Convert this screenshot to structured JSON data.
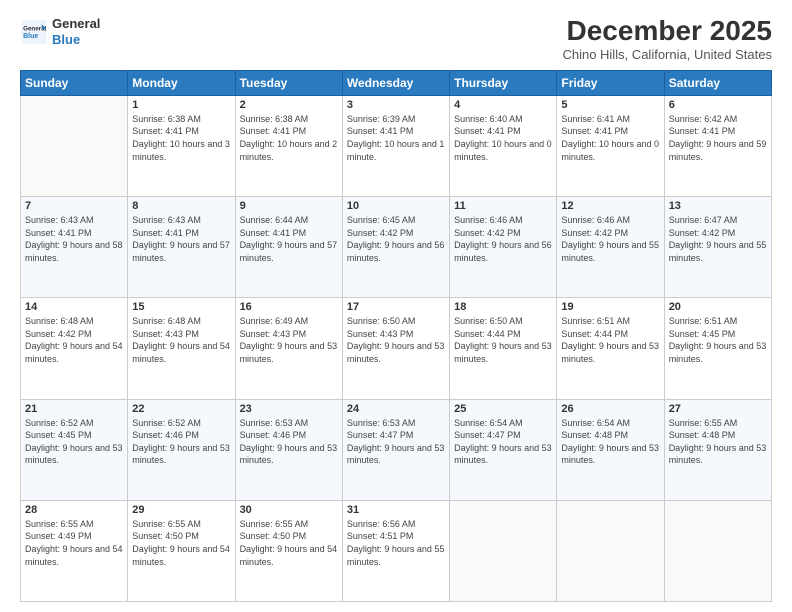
{
  "header": {
    "logo": {
      "general": "General",
      "blue": "Blue"
    },
    "title": "December 2025",
    "location": "Chino Hills, California, United States"
  },
  "days_of_week": [
    "Sunday",
    "Monday",
    "Tuesday",
    "Wednesday",
    "Thursday",
    "Friday",
    "Saturday"
  ],
  "weeks": [
    [
      {
        "day": "",
        "sunrise": "",
        "sunset": "",
        "daylight": ""
      },
      {
        "day": "1",
        "sunrise": "Sunrise: 6:38 AM",
        "sunset": "Sunset: 4:41 PM",
        "daylight": "Daylight: 10 hours and 3 minutes."
      },
      {
        "day": "2",
        "sunrise": "Sunrise: 6:38 AM",
        "sunset": "Sunset: 4:41 PM",
        "daylight": "Daylight: 10 hours and 2 minutes."
      },
      {
        "day": "3",
        "sunrise": "Sunrise: 6:39 AM",
        "sunset": "Sunset: 4:41 PM",
        "daylight": "Daylight: 10 hours and 1 minute."
      },
      {
        "day": "4",
        "sunrise": "Sunrise: 6:40 AM",
        "sunset": "Sunset: 4:41 PM",
        "daylight": "Daylight: 10 hours and 0 minutes."
      },
      {
        "day": "5",
        "sunrise": "Sunrise: 6:41 AM",
        "sunset": "Sunset: 4:41 PM",
        "daylight": "Daylight: 10 hours and 0 minutes."
      },
      {
        "day": "6",
        "sunrise": "Sunrise: 6:42 AM",
        "sunset": "Sunset: 4:41 PM",
        "daylight": "Daylight: 9 hours and 59 minutes."
      }
    ],
    [
      {
        "day": "7",
        "sunrise": "Sunrise: 6:43 AM",
        "sunset": "Sunset: 4:41 PM",
        "daylight": "Daylight: 9 hours and 58 minutes."
      },
      {
        "day": "8",
        "sunrise": "Sunrise: 6:43 AM",
        "sunset": "Sunset: 4:41 PM",
        "daylight": "Daylight: 9 hours and 57 minutes."
      },
      {
        "day": "9",
        "sunrise": "Sunrise: 6:44 AM",
        "sunset": "Sunset: 4:41 PM",
        "daylight": "Daylight: 9 hours and 57 minutes."
      },
      {
        "day": "10",
        "sunrise": "Sunrise: 6:45 AM",
        "sunset": "Sunset: 4:42 PM",
        "daylight": "Daylight: 9 hours and 56 minutes."
      },
      {
        "day": "11",
        "sunrise": "Sunrise: 6:46 AM",
        "sunset": "Sunset: 4:42 PM",
        "daylight": "Daylight: 9 hours and 56 minutes."
      },
      {
        "day": "12",
        "sunrise": "Sunrise: 6:46 AM",
        "sunset": "Sunset: 4:42 PM",
        "daylight": "Daylight: 9 hours and 55 minutes."
      },
      {
        "day": "13",
        "sunrise": "Sunrise: 6:47 AM",
        "sunset": "Sunset: 4:42 PM",
        "daylight": "Daylight: 9 hours and 55 minutes."
      }
    ],
    [
      {
        "day": "14",
        "sunrise": "Sunrise: 6:48 AM",
        "sunset": "Sunset: 4:42 PM",
        "daylight": "Daylight: 9 hours and 54 minutes."
      },
      {
        "day": "15",
        "sunrise": "Sunrise: 6:48 AM",
        "sunset": "Sunset: 4:43 PM",
        "daylight": "Daylight: 9 hours and 54 minutes."
      },
      {
        "day": "16",
        "sunrise": "Sunrise: 6:49 AM",
        "sunset": "Sunset: 4:43 PM",
        "daylight": "Daylight: 9 hours and 53 minutes."
      },
      {
        "day": "17",
        "sunrise": "Sunrise: 6:50 AM",
        "sunset": "Sunset: 4:43 PM",
        "daylight": "Daylight: 9 hours and 53 minutes."
      },
      {
        "day": "18",
        "sunrise": "Sunrise: 6:50 AM",
        "sunset": "Sunset: 4:44 PM",
        "daylight": "Daylight: 9 hours and 53 minutes."
      },
      {
        "day": "19",
        "sunrise": "Sunrise: 6:51 AM",
        "sunset": "Sunset: 4:44 PM",
        "daylight": "Daylight: 9 hours and 53 minutes."
      },
      {
        "day": "20",
        "sunrise": "Sunrise: 6:51 AM",
        "sunset": "Sunset: 4:45 PM",
        "daylight": "Daylight: 9 hours and 53 minutes."
      }
    ],
    [
      {
        "day": "21",
        "sunrise": "Sunrise: 6:52 AM",
        "sunset": "Sunset: 4:45 PM",
        "daylight": "Daylight: 9 hours and 53 minutes."
      },
      {
        "day": "22",
        "sunrise": "Sunrise: 6:52 AM",
        "sunset": "Sunset: 4:46 PM",
        "daylight": "Daylight: 9 hours and 53 minutes."
      },
      {
        "day": "23",
        "sunrise": "Sunrise: 6:53 AM",
        "sunset": "Sunset: 4:46 PM",
        "daylight": "Daylight: 9 hours and 53 minutes."
      },
      {
        "day": "24",
        "sunrise": "Sunrise: 6:53 AM",
        "sunset": "Sunset: 4:47 PM",
        "daylight": "Daylight: 9 hours and 53 minutes."
      },
      {
        "day": "25",
        "sunrise": "Sunrise: 6:54 AM",
        "sunset": "Sunset: 4:47 PM",
        "daylight": "Daylight: 9 hours and 53 minutes."
      },
      {
        "day": "26",
        "sunrise": "Sunrise: 6:54 AM",
        "sunset": "Sunset: 4:48 PM",
        "daylight": "Daylight: 9 hours and 53 minutes."
      },
      {
        "day": "27",
        "sunrise": "Sunrise: 6:55 AM",
        "sunset": "Sunset: 4:48 PM",
        "daylight": "Daylight: 9 hours and 53 minutes."
      }
    ],
    [
      {
        "day": "28",
        "sunrise": "Sunrise: 6:55 AM",
        "sunset": "Sunset: 4:49 PM",
        "daylight": "Daylight: 9 hours and 54 minutes."
      },
      {
        "day": "29",
        "sunrise": "Sunrise: 6:55 AM",
        "sunset": "Sunset: 4:50 PM",
        "daylight": "Daylight: 9 hours and 54 minutes."
      },
      {
        "day": "30",
        "sunrise": "Sunrise: 6:55 AM",
        "sunset": "Sunset: 4:50 PM",
        "daylight": "Daylight: 9 hours and 54 minutes."
      },
      {
        "day": "31",
        "sunrise": "Sunrise: 6:56 AM",
        "sunset": "Sunset: 4:51 PM",
        "daylight": "Daylight: 9 hours and 55 minutes."
      },
      {
        "day": "",
        "sunrise": "",
        "sunset": "",
        "daylight": ""
      },
      {
        "day": "",
        "sunrise": "",
        "sunset": "",
        "daylight": ""
      },
      {
        "day": "",
        "sunrise": "",
        "sunset": "",
        "daylight": ""
      }
    ]
  ]
}
